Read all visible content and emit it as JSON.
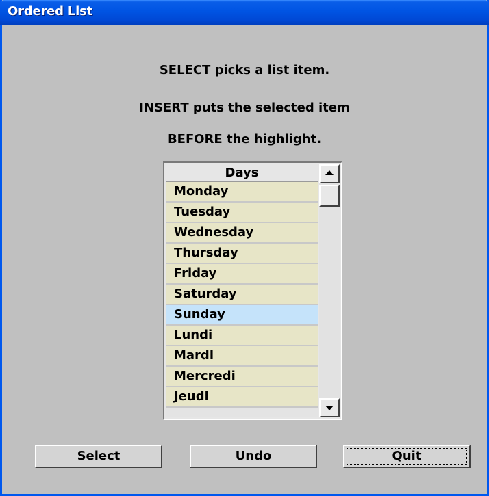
{
  "window": {
    "title": "Ordered List"
  },
  "instructions": [
    "SELECT picks a list item.",
    "INSERT puts the selected item",
    "BEFORE the highlight."
  ],
  "list": {
    "header": "Days",
    "items": [
      "Monday",
      "Tuesday",
      "Wednesday",
      "Thursday",
      "Friday",
      "Saturday",
      "Sunday",
      "Lundi",
      "Mardi",
      "Mercredi",
      "Jeudi"
    ],
    "selected_item": "Sunday"
  },
  "buttons": {
    "select_label": "Select",
    "undo_label": "Undo",
    "quit_label": "Quit"
  },
  "icons": {
    "scroll_up": "arrow-up-icon",
    "scroll_down": "arrow-down-icon"
  },
  "colors": {
    "titlebar": "#0054e3",
    "list_item_bg": "#e7e5c7",
    "selected_bg": "#c5e3fa",
    "window_bg": "#c0c0c0"
  }
}
